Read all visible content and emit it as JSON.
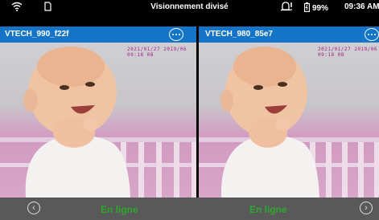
{
  "status_bar": {
    "title": "Visionnement divisé",
    "battery": "99%",
    "time": "09:36 AM",
    "icons": [
      "wifi-icon",
      "sd-card-icon",
      "sound-alert-icon",
      "battery-icon"
    ]
  },
  "cameras": [
    {
      "name": "VTECH_990_f22f",
      "timestamp": "2021/01/27 2019/06 09:18 08",
      "status": "En ligne"
    },
    {
      "name": "VTECH_980_85e7",
      "timestamp": "2021/01/27 2019/06 09:18 08",
      "status": "En ligne"
    }
  ],
  "colors": {
    "header_blue": "#1474c8",
    "online_green": "#2ea82e",
    "bottom_bar": "#595959",
    "timestamp_magenta": "#a3208a"
  },
  "nav": {
    "prev_icon": "chevron-left-icon",
    "next_icon": "chevron-right-icon"
  }
}
